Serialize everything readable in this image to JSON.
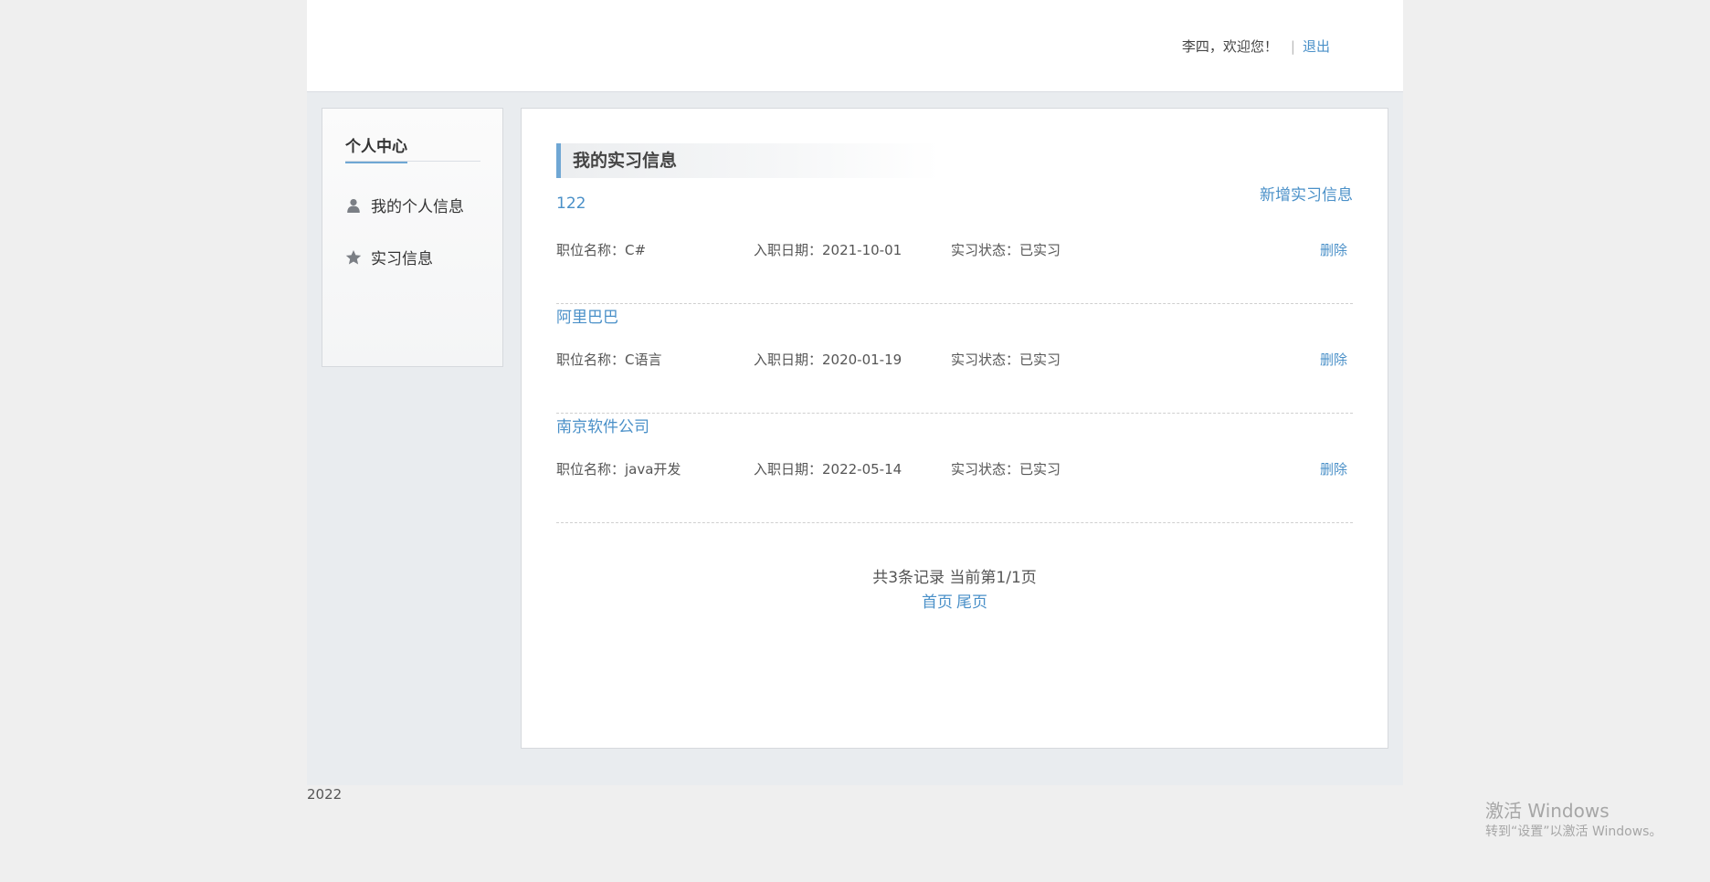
{
  "header": {
    "welcome": "李四，欢迎您！",
    "separator": "|",
    "logout": "退出"
  },
  "sidebar": {
    "title": "个人中心",
    "items": [
      {
        "label": "我的个人信息",
        "icon": "user-icon"
      },
      {
        "label": "实习信息",
        "icon": "star-icon"
      }
    ]
  },
  "main": {
    "title": "我的实习信息",
    "add_link": "新增实习信息",
    "records": [
      {
        "company": "122",
        "position": "职位名称：C#",
        "date": "入职日期：2021-10-01",
        "status": "实习状态：已实习",
        "delete": "删除"
      },
      {
        "company": "阿里巴巴",
        "position": "职位名称：C语言",
        "date": "入职日期：2020-01-19",
        "status": "实习状态：已实习",
        "delete": "删除"
      },
      {
        "company": "南京软件公司",
        "position": "职位名称：java开发",
        "date": "入职日期：2022-05-14",
        "status": "实习状态：已实习",
        "delete": "删除"
      }
    ],
    "pager": {
      "info": "共3条记录 当前第1/1页",
      "first": "首页",
      "last": "尾页"
    }
  },
  "footer": {
    "year": "2022"
  },
  "watermark": {
    "line1": "激活 Windows",
    "line2": "转到“设置”以激活 Windows。"
  },
  "colors": {
    "accent": "#4a90c8",
    "page_bg": "#efefef",
    "content_bg": "#e9ecef"
  }
}
